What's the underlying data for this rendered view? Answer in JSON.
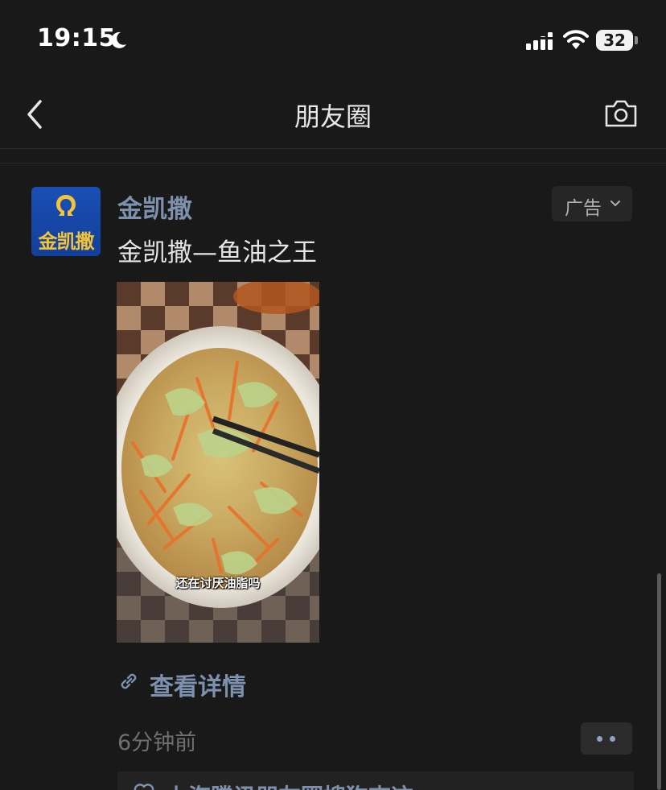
{
  "status_bar": {
    "time": "19:15",
    "battery": "32"
  },
  "nav": {
    "title": "朋友圈"
  },
  "post": {
    "avatar_text": "金凯撒",
    "name": "金凯撒",
    "ad_label": "广告",
    "text": "金凯撒—鱼油之王",
    "image_caption": "还在讨厌油脂吗",
    "link_text": "查看详情",
    "time": "6分钟前",
    "likes_text": "上海腾讯朋友圈搜狗查这"
  },
  "colors": {
    "background": "#191919",
    "link_blue": "#7d90ad",
    "avatar_blue": "#1b4fb5",
    "avatar_gold": "#f3c437"
  },
  "icons": [
    "moon-icon",
    "signal-icon",
    "wifi-icon",
    "back-icon",
    "camera-icon",
    "chevron-down-icon",
    "link-icon",
    "heart-icon"
  ]
}
